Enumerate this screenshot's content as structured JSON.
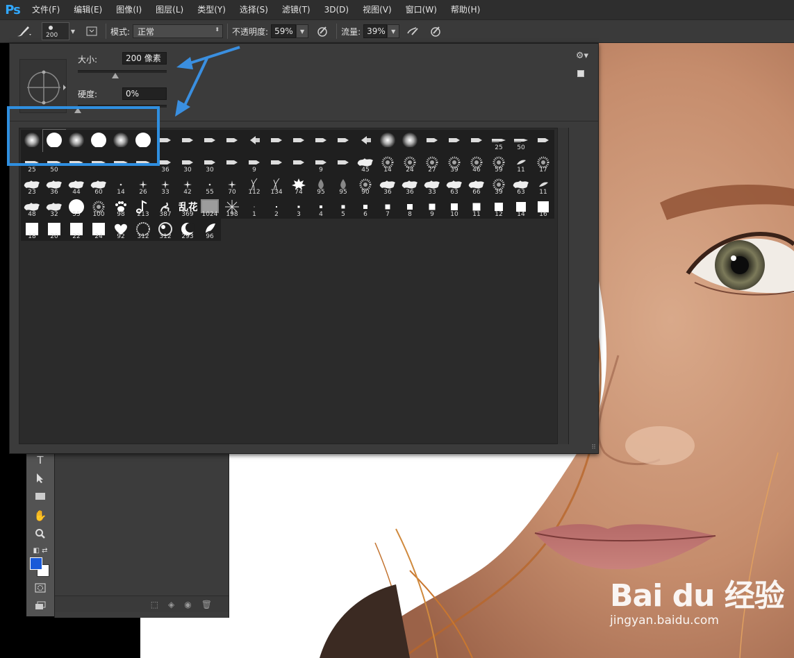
{
  "app": {
    "logo": "Ps"
  },
  "menu": [
    "文件(F)",
    "编辑(E)",
    "图像(I)",
    "图层(L)",
    "类型(Y)",
    "选择(S)",
    "滤镜(T)",
    "3D(D)",
    "视图(V)",
    "窗口(W)",
    "帮助(H)"
  ],
  "options": {
    "brush_size": "200",
    "mode_label": "模式:",
    "mode_value": "正常",
    "opacity_label": "不透明度:",
    "opacity_value": "59%",
    "flow_label": "流量:",
    "flow_value": "39%"
  },
  "picker": {
    "size_label": "大小:",
    "size_value": "200 像素",
    "size_level": 0.42,
    "hardness_label": "硬度:",
    "hardness_value": "0%",
    "hardness_level": 0.0
  },
  "brushes": [
    {
      "k": "soft",
      "n": ""
    },
    {
      "k": "hard",
      "n": ""
    },
    {
      "k": "soft",
      "n": ""
    },
    {
      "k": "hard",
      "n": ""
    },
    {
      "k": "soft",
      "n": ""
    },
    {
      "k": "hard",
      "n": ""
    },
    {
      "k": "tip",
      "n": ""
    },
    {
      "k": "tip",
      "n": ""
    },
    {
      "k": "tip",
      "n": ""
    },
    {
      "k": "tip",
      "n": ""
    },
    {
      "k": "fan",
      "n": ""
    },
    {
      "k": "tip",
      "n": ""
    },
    {
      "k": "tip",
      "n": ""
    },
    {
      "k": "tip",
      "n": ""
    },
    {
      "k": "tip",
      "n": ""
    },
    {
      "k": "fan",
      "n": ""
    },
    {
      "k": "soft",
      "n": ""
    },
    {
      "k": "soft",
      "n": ""
    },
    {
      "k": "tip",
      "n": ""
    },
    {
      "k": "tip",
      "n": ""
    },
    {
      "k": "tip",
      "n": ""
    },
    {
      "k": "pen",
      "n": "25"
    },
    {
      "k": "pen",
      "n": "50"
    },
    {
      "k": "tip",
      "n": ""
    },
    {
      "k": "pen",
      "n": "25"
    },
    {
      "k": "pen",
      "n": "50"
    },
    {
      "k": "pen",
      "n": ""
    },
    {
      "k": "pen",
      "n": ""
    },
    {
      "k": "pen",
      "n": ""
    },
    {
      "k": "pen",
      "n": ""
    },
    {
      "k": "tip",
      "n": "36"
    },
    {
      "k": "tip",
      "n": "30"
    },
    {
      "k": "tip",
      "n": "30"
    },
    {
      "k": "tip",
      "n": ""
    },
    {
      "k": "tip",
      "n": "9"
    },
    {
      "k": "tip",
      "n": ""
    },
    {
      "k": "tip",
      "n": ""
    },
    {
      "k": "tip",
      "n": "9"
    },
    {
      "k": "tip",
      "n": ""
    },
    {
      "k": "splat",
      "n": "45"
    },
    {
      "k": "spray",
      "n": "14"
    },
    {
      "k": "spray",
      "n": "24"
    },
    {
      "k": "spray",
      "n": "27"
    },
    {
      "k": "spray",
      "n": "39"
    },
    {
      "k": "spray",
      "n": "46"
    },
    {
      "k": "spray",
      "n": "59"
    },
    {
      "k": "leaf",
      "n": "11"
    },
    {
      "k": "spray",
      "n": "17"
    },
    {
      "k": "splat",
      "n": "23"
    },
    {
      "k": "splat",
      "n": "36"
    },
    {
      "k": "splat",
      "n": "44"
    },
    {
      "k": "splat",
      "n": "60"
    },
    {
      "k": "dot",
      "n": "14"
    },
    {
      "k": "star",
      "n": "26"
    },
    {
      "k": "star",
      "n": "33"
    },
    {
      "k": "star",
      "n": "42"
    },
    {
      "k": "dot",
      "n": "55"
    },
    {
      "k": "star",
      "n": "70"
    },
    {
      "k": "grass",
      "n": "112"
    },
    {
      "k": "grass",
      "n": "134"
    },
    {
      "k": "maple",
      "n": "74"
    },
    {
      "k": "drop",
      "n": "95"
    },
    {
      "k": "drop",
      "n": "95"
    },
    {
      "k": "spray",
      "n": "90"
    },
    {
      "k": "splat",
      "n": "36"
    },
    {
      "k": "splat",
      "n": "36"
    },
    {
      "k": "splat",
      "n": "33"
    },
    {
      "k": "splat",
      "n": "63"
    },
    {
      "k": "splat",
      "n": "66"
    },
    {
      "k": "spray",
      "n": "39"
    },
    {
      "k": "splat",
      "n": "63"
    },
    {
      "k": "leaf",
      "n": "11"
    },
    {
      "k": "splat",
      "n": "48"
    },
    {
      "k": "splat",
      "n": "32"
    },
    {
      "k": "hard",
      "n": "55"
    },
    {
      "k": "spray",
      "n": "100"
    },
    {
      "k": "paw",
      "n": "98"
    },
    {
      "k": "note",
      "n": "213"
    },
    {
      "k": "swirl",
      "n": "387"
    },
    {
      "k": "text",
      "n": "369"
    },
    {
      "k": "texture",
      "n": "1024"
    },
    {
      "k": "starburst",
      "n": "198"
    },
    {
      "k": "sq",
      "s": 1,
      "n": "1"
    },
    {
      "k": "sq",
      "s": 2,
      "n": "2"
    },
    {
      "k": "sq",
      "s": 3,
      "n": "3"
    },
    {
      "k": "sq",
      "s": 4,
      "n": "4"
    },
    {
      "k": "sq",
      "s": 5,
      "n": "5"
    },
    {
      "k": "sq",
      "s": 6,
      "n": "6"
    },
    {
      "k": "sq",
      "s": 7,
      "n": "7"
    },
    {
      "k": "sq",
      "s": 8,
      "n": "8"
    },
    {
      "k": "sq",
      "s": 9,
      "n": "9"
    },
    {
      "k": "sq",
      "s": 10,
      "n": "10"
    },
    {
      "k": "sq",
      "s": 11,
      "n": "11"
    },
    {
      "k": "sq",
      "s": 12,
      "n": "12"
    },
    {
      "k": "sq",
      "s": 14,
      "n": "14"
    },
    {
      "k": "sq",
      "s": 16,
      "n": "16"
    },
    {
      "k": "sq",
      "s": 18,
      "n": "18"
    },
    {
      "k": "sq",
      "s": 18,
      "n": "20"
    },
    {
      "k": "sq",
      "s": 18,
      "n": "22"
    },
    {
      "k": "sq",
      "s": 18,
      "n": "24"
    },
    {
      "k": "heart",
      "n": "92"
    },
    {
      "k": "ring",
      "n": "312"
    },
    {
      "k": "ring2",
      "n": "312"
    },
    {
      "k": "moon",
      "n": "293"
    },
    {
      "k": "petal",
      "n": "96"
    }
  ],
  "brush_text_glyph": "乱花",
  "watermark": {
    "main": "Bai du 经验",
    "sub": "jingyan.baidu.com"
  },
  "colors": {
    "accent": "#2f8fe0",
    "ps_blue": "#31a8ff",
    "foreground": "#1a5ad8",
    "background": "#ffffff"
  }
}
